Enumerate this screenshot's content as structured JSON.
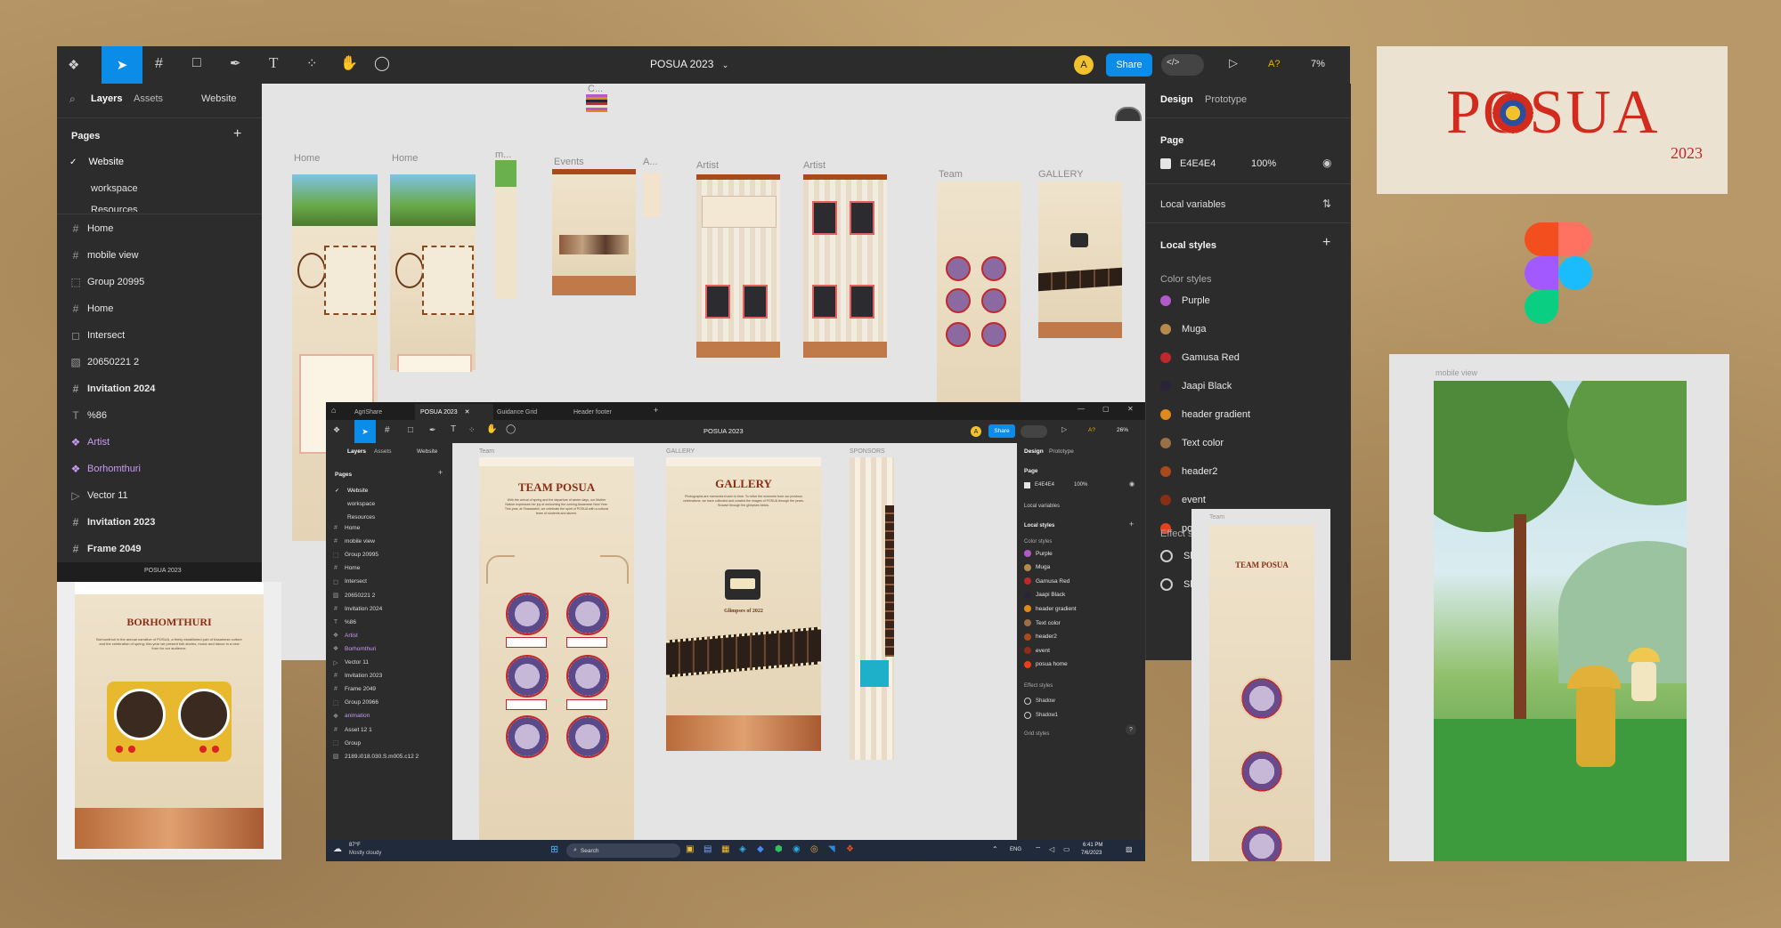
{
  "main_window": {
    "doc_title": "POSUA 2023",
    "toolbar": {
      "share": "Share",
      "zoom": "7%",
      "avatar": "A",
      "user_short": "A?"
    },
    "left_tabs": {
      "layers": "Layers",
      "assets": "Assets",
      "page_selector": "Website"
    },
    "pages_heading": "Pages",
    "pages": [
      "Website",
      "workspace",
      "Resources"
    ],
    "layers": [
      {
        "icon": "frame",
        "label": "Home"
      },
      {
        "icon": "frame",
        "label": "mobile view"
      },
      {
        "icon": "group",
        "label": "Group 20995"
      },
      {
        "icon": "frame",
        "label": "Home"
      },
      {
        "icon": "intersect",
        "label": "Intersect"
      },
      {
        "icon": "image",
        "label": "20650221 2"
      },
      {
        "icon": "frame",
        "label": "Invitation 2024"
      },
      {
        "icon": "text",
        "label": "%86"
      },
      {
        "icon": "component",
        "label": "Artist"
      },
      {
        "icon": "component",
        "label": "Borhomthuri"
      },
      {
        "icon": "vector",
        "label": "Vector 11"
      },
      {
        "icon": "frame",
        "label": "Invitation 2023"
      },
      {
        "icon": "frame",
        "label": "Frame 2049"
      }
    ],
    "footer_label": "POSUA 2023",
    "canvas_labels": {
      "home1": "Home",
      "home2": "Home",
      "m": "m...",
      "events": "Events",
      "a": "A...",
      "artist1": "Artist",
      "artist2": "Artist",
      "team": "Team",
      "gallery": "GALLERY",
      "c": "C..."
    },
    "right_tabs": {
      "design": "Design",
      "prototype": "Prototype"
    },
    "page_section": {
      "title": "Page",
      "color": "E4E4E4",
      "opacity": "100%"
    },
    "local_variables": "Local variables",
    "local_styles": "Local styles",
    "color_styles_heading": "Color styles",
    "color_styles": [
      {
        "name": "Purple",
        "color": "#b45ac8"
      },
      {
        "name": "Muga",
        "color": "#b8894a"
      },
      {
        "name": "Gamusa Red",
        "color": "#c0282c"
      },
      {
        "name": "Jaapi Black",
        "color": "#2a2438"
      },
      {
        "name": "header gradient",
        "color": "#e08a1e"
      },
      {
        "name": "Text color",
        "color": "#9a7046"
      },
      {
        "name": "header2",
        "color": "#a84a1c"
      },
      {
        "name": "event",
        "color": "#8a2e16"
      },
      {
        "name": "po",
        "color": "#e8401c"
      }
    ],
    "effect_heading": "Effect s",
    "effects": [
      "Sh",
      "Sh"
    ]
  },
  "logo_card": {
    "logo_text": "POSUA",
    "year": "2023"
  },
  "mobile_card": {
    "label": "mobile view"
  },
  "borhomthuri_card": {
    "title": "BORHOMTHURI",
    "body": "Borhomthuri is the annual narrative of POSUA, a firmly established part of Assamese culture and the celebration of spring; this year we present folk stories, music and dance in a new form for our audience."
  },
  "team_small_card": {
    "label": "Team",
    "title": "TEAM POSUA"
  },
  "inner_window": {
    "tabs": [
      "AgriShare",
      "POSUA 2023",
      "Guidance Grid",
      "Header footer"
    ],
    "doc_title": "POSUA 2023",
    "toolbar": {
      "share": "Share",
      "zoom": "26%",
      "avatar": "A",
      "user_short": "A?"
    },
    "left_tabs": {
      "layers": "Layers",
      "assets": "Assets",
      "page_selector": "Website"
    },
    "pages_heading": "Pages",
    "pages": [
      "Website",
      "workspace",
      "Resources"
    ],
    "layers": [
      {
        "icon": "frame",
        "label": "Home"
      },
      {
        "icon": "frame",
        "label": "mobile view"
      },
      {
        "icon": "group",
        "label": "Group 20995"
      },
      {
        "icon": "frame",
        "label": "Home"
      },
      {
        "icon": "intersect",
        "label": "Intersect"
      },
      {
        "icon": "image",
        "label": "20650221 2"
      },
      {
        "icon": "frame",
        "label": "Invitation 2024"
      },
      {
        "icon": "text",
        "label": "%86"
      },
      {
        "icon": "component",
        "label": "Artist"
      },
      {
        "icon": "component",
        "label": "Borhomthuri"
      },
      {
        "icon": "vector",
        "label": "Vector 11"
      },
      {
        "icon": "frame",
        "label": "Invitation 2023"
      },
      {
        "icon": "frame",
        "label": "Frame 2049"
      },
      {
        "icon": "group",
        "label": "Group 20966"
      },
      {
        "icon": "component",
        "label": "animation"
      },
      {
        "icon": "frame",
        "label": "Asset 12 1"
      },
      {
        "icon": "group",
        "label": "Group"
      },
      {
        "icon": "image",
        "label": "2189.i018.030.S.m005.c12 2"
      }
    ],
    "canvas_labels": {
      "team": "Team",
      "gallery": "GALLERY",
      "sponsors": "SPONSORS"
    },
    "team_title": "TEAM POSUA",
    "team_body": "With the arrival of spring and the departure of winter days, our Mother Nature expresses her joy of welcoming the coming Assamese New Year. This year, at Sharadabhi, we celebrate the spirit of POSUA with a cultural team of students and alumni.",
    "gallery_title": "GALLERY",
    "gallery_body": "Photographs are memories frozen in time. To relive the moments from our previous celebrations, we have collected and curated the images of POSUA through the years. Browse through the glimpses below.",
    "gallery_caption": "Glimpses of 2022",
    "right": {
      "design": "Design",
      "prototype": "Prototype",
      "page": "Page",
      "color": "E4E4E4",
      "opacity": "100%",
      "local_variables": "Local variables",
      "local_styles": "Local styles",
      "color_styles": "Color styles",
      "styles": [
        {
          "name": "Purple",
          "color": "#b45ac8"
        },
        {
          "name": "Muga",
          "color": "#b8894a"
        },
        {
          "name": "Gamusa Red",
          "color": "#c0282c"
        },
        {
          "name": "Jaapi Black",
          "color": "#2a2438"
        },
        {
          "name": "header gradient",
          "color": "#e08a1e"
        },
        {
          "name": "Text color",
          "color": "#9a7046"
        },
        {
          "name": "header2",
          "color": "#a84a1c"
        },
        {
          "name": "event",
          "color": "#8a2e16"
        },
        {
          "name": "posua home",
          "color": "#e8401c"
        }
      ],
      "effect_styles": "Effect styles",
      "effects": [
        "Shadow",
        "Shadow1"
      ],
      "grid_styles": "Grid styles"
    },
    "taskbar": {
      "weather_temp": "87°F",
      "weather_desc": "Mostly cloudy",
      "search": "Search",
      "lang": "ENG",
      "time": "6:41 PM",
      "date": "7/6/2023"
    }
  }
}
